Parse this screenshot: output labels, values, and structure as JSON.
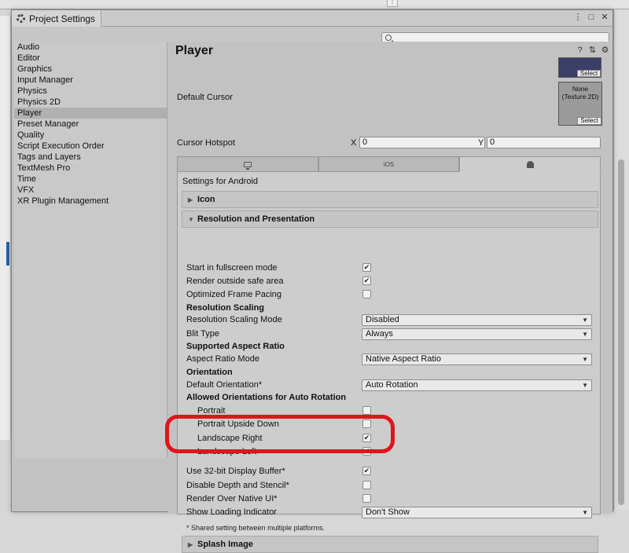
{
  "window": {
    "title": "Project Settings"
  },
  "search": {
    "placeholder": ""
  },
  "sidebar": {
    "items": [
      "Audio",
      "Editor",
      "Graphics",
      "Input Manager",
      "Physics",
      "Physics 2D",
      "Player",
      "Preset Manager",
      "Quality",
      "Script Execution Order",
      "Tags and Layers",
      "TextMesh Pro",
      "Time",
      "VFX",
      "XR Plugin Management"
    ],
    "selected": "Player"
  },
  "header": {
    "title": "Player"
  },
  "cursor": {
    "default_label": "Default Cursor",
    "texture_none": "None",
    "texture_type": "(Texture 2D)",
    "select_label": "Select",
    "hotspot_label": "Cursor Hotspot",
    "x_label": "X",
    "x_value": "0",
    "y_label": "Y",
    "y_value": "0"
  },
  "platforms": {
    "ios_label": "iOS",
    "active": "android"
  },
  "settings_for": "Settings for Android",
  "sections": {
    "icon": "Icon",
    "resolution": "Resolution and Presentation",
    "splash": "Splash Image"
  },
  "resolution_rows": [
    {
      "label": "Start in fullscreen mode",
      "type": "checkbox",
      "checked": true
    },
    {
      "label": "Render outside safe area",
      "type": "checkbox",
      "checked": true
    },
    {
      "label": "Optimized Frame Pacing",
      "type": "checkbox",
      "checked": false
    },
    {
      "label": "Resolution Scaling",
      "type": "header"
    },
    {
      "label": "Resolution Scaling Mode",
      "type": "dropdown",
      "value": "Disabled"
    },
    {
      "label": "Blit Type",
      "type": "dropdown",
      "value": "Always"
    },
    {
      "label": "Supported Aspect Ratio",
      "type": "header"
    },
    {
      "label": "Aspect Ratio Mode",
      "type": "dropdown",
      "value": "Native Aspect Ratio"
    },
    {
      "label": "Orientation",
      "type": "header"
    },
    {
      "label": "Default Orientation*",
      "type": "dropdown",
      "value": "Auto Rotation"
    },
    {
      "label": "Allowed Orientations for Auto Rotation",
      "type": "header"
    },
    {
      "label": "Portrait",
      "type": "checkbox",
      "checked": false,
      "indent": true
    },
    {
      "label": "Portrait Upside Down",
      "type": "checkbox",
      "checked": false,
      "indent": true
    },
    {
      "label": "Landscape Right",
      "type": "checkbox",
      "checked": true,
      "indent": true
    },
    {
      "label": "Landscape Left",
      "type": "checkbox",
      "checked": true,
      "indent": true
    },
    {
      "label": "Use 32-bit Display Buffer*",
      "type": "checkbox",
      "checked": true
    },
    {
      "label": "Disable Depth and Stencil*",
      "type": "checkbox",
      "checked": false
    },
    {
      "label": "Render Over Native UI*",
      "type": "checkbox",
      "checked": false
    },
    {
      "label": "Show Loading Indicator",
      "type": "dropdown",
      "value": "Don't Show"
    }
  ],
  "footnote": "* Shared setting between multiple platforms.",
  "colors": {
    "annotation": "#e0151b",
    "selection": "#b0b0b0"
  }
}
